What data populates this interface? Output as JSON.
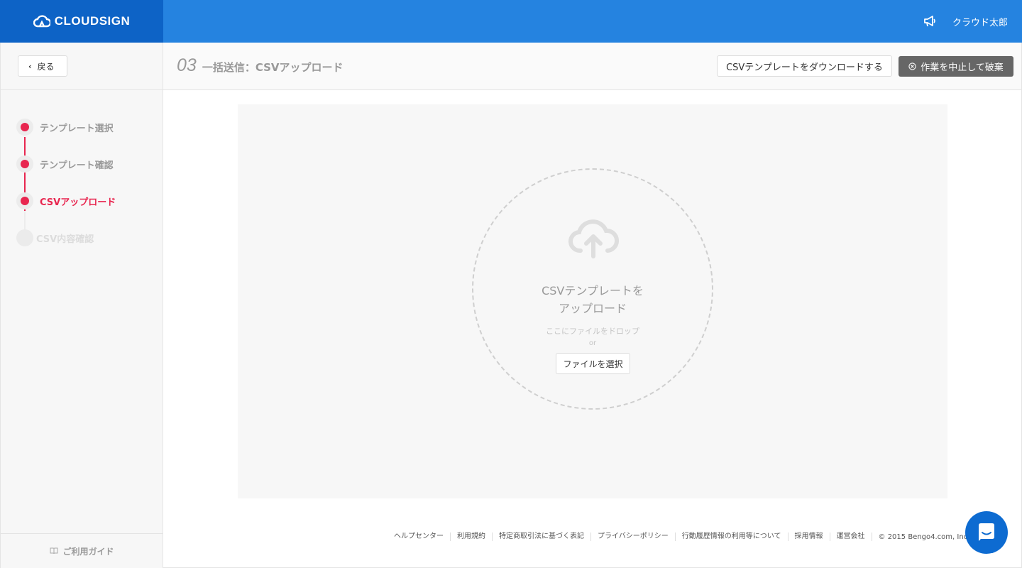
{
  "header": {
    "logo_text": "CLOUDSIGN",
    "user_name": "クラウド太郎"
  },
  "sidebar": {
    "back_label": "戻る",
    "steps": [
      {
        "label": "テンプレート選択",
        "state": "done"
      },
      {
        "label": "テンプレート確認",
        "state": "done"
      },
      {
        "label": "CSVアップロード",
        "state": "active"
      },
      {
        "label": "CSV内容確認",
        "state": "pending"
      }
    ],
    "guide_label": "ご利用ガイド"
  },
  "page": {
    "step_number": "03",
    "title": "一括送信：CSVアップロード",
    "download_label": "CSVテンプレートをダウンロードする",
    "abort_label": "作業を中止して破棄"
  },
  "upload": {
    "title_line1": "CSVテンプレートを",
    "title_line2": "アップロード",
    "hint": "ここにファイルをドロップ",
    "or": "or",
    "select_label": "ファイルを選択"
  },
  "footer": {
    "links": [
      "ヘルプセンター",
      "利用規約",
      "特定商取引法に基づく表記",
      "プライバシーポリシー",
      "行動履歴情報の利用等について",
      "採用情報",
      "運営会社"
    ],
    "copyright": "© 2015 Bengo4.com, Inc."
  },
  "colors": {
    "header_blue": "#2583e0",
    "logo_blue": "#0d63c6",
    "accent_red": "#e8264f",
    "abort_grey": "#666666"
  },
  "icons": [
    "cloud-logo-icon",
    "megaphone-icon",
    "chevron-left-icon",
    "book-icon",
    "close-circle-icon",
    "cloud-upload-icon",
    "chat-icon"
  ]
}
